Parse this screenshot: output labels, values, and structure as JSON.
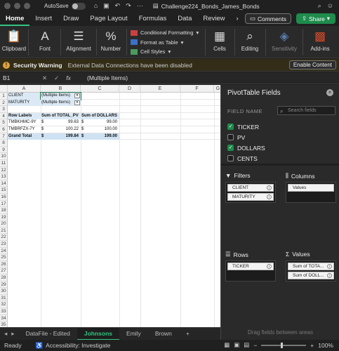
{
  "window": {
    "autosave_label": "AutoSave",
    "autosave_state": "off",
    "title": "Challenge224_Bonds_James_Bonds"
  },
  "ribbon_tabs": [
    "Home",
    "Insert",
    "Draw",
    "Page Layout",
    "Formulas",
    "Data",
    "Review"
  ],
  "ribbon_buttons": {
    "comments": "Comments",
    "share": "Share",
    "clipboard": "Clipboard",
    "font": "Font",
    "alignment": "Alignment",
    "number": "Number",
    "conditional_formatting": "Conditional Formatting",
    "format_as_table": "Format as Table",
    "cell_styles": "Cell Styles",
    "cells": "Cells",
    "editing": "Editing",
    "sensitivity": "Sensitivity",
    "addins": "Add-ins"
  },
  "security": {
    "title": "Security Warning",
    "message": "External Data Connections have been disabled",
    "button": "Enable Content"
  },
  "formula_bar": {
    "name_box": "B1",
    "fx": "fx",
    "value": "(Multiple Items)"
  },
  "columns": [
    "A",
    "B",
    "C",
    "D",
    "E",
    "F",
    "G"
  ],
  "rows": [
    "1",
    "2",
    "3",
    "4",
    "5",
    "6",
    "7",
    "8",
    "9",
    "10",
    "11",
    "12",
    "13",
    "14",
    "15",
    "16",
    "17",
    "18",
    "19",
    "20",
    "21",
    "22",
    "23",
    "24",
    "25",
    "26",
    "27",
    "28",
    "29",
    "30",
    "31",
    "32",
    "33",
    "34",
    "35"
  ],
  "pivot": {
    "filters": [
      {
        "label": "CLIENT",
        "value": "(Multiple Items)"
      },
      {
        "label": "MATURITY",
        "value": "(Multiple Items)"
      }
    ],
    "header": {
      "row_labels": "Row Labels",
      "sum_pv": "Sum of TOTAL_PV",
      "sum_dollars": "Sum of DOLLARS"
    },
    "rows": [
      {
        "label": "TMBKHMC-9Y",
        "cur1": "$",
        "pv": "99.63",
        "cur2": "$",
        "dollars": "99.00"
      },
      {
        "label": "TMBRFZX-7Y",
        "cur1": "$",
        "pv": "100.22",
        "cur2": "$",
        "dollars": "100.00"
      }
    ],
    "grand_total": {
      "label": "Grand Total",
      "cur1": "$",
      "pv": "199.84",
      "cur2": "$",
      "dollars": "199.00"
    }
  },
  "sheet_tabs": [
    "DataFile - Edited",
    "Johnsons",
    "Emily",
    "Brown"
  ],
  "active_sheet": "Johnsons",
  "status": {
    "ready": "Ready",
    "accessibility": "Accessibility: Investigate",
    "zoom": "100%"
  },
  "pane": {
    "title": "PivotTable Fields",
    "field_name_label": "FIELD NAME",
    "search_placeholder": "Search fields",
    "fields": [
      {
        "name": "TICKER",
        "checked": true
      },
      {
        "name": "PV",
        "checked": false
      },
      {
        "name": "DOLLARS",
        "checked": true
      },
      {
        "name": "CENTS",
        "checked": false
      }
    ],
    "areas": {
      "filters_title": "Filters",
      "columns_title": "Columns",
      "rows_title": "Rows",
      "values_title": "Values",
      "filters": [
        "CLIENT",
        "MATURITY"
      ],
      "columns": [
        "Values"
      ],
      "rows": [
        "TICKER"
      ],
      "values": [
        "Sum of TOTA...",
        "Sum of DOLL..."
      ]
    },
    "drag_hint": "Drag fields between areas"
  }
}
